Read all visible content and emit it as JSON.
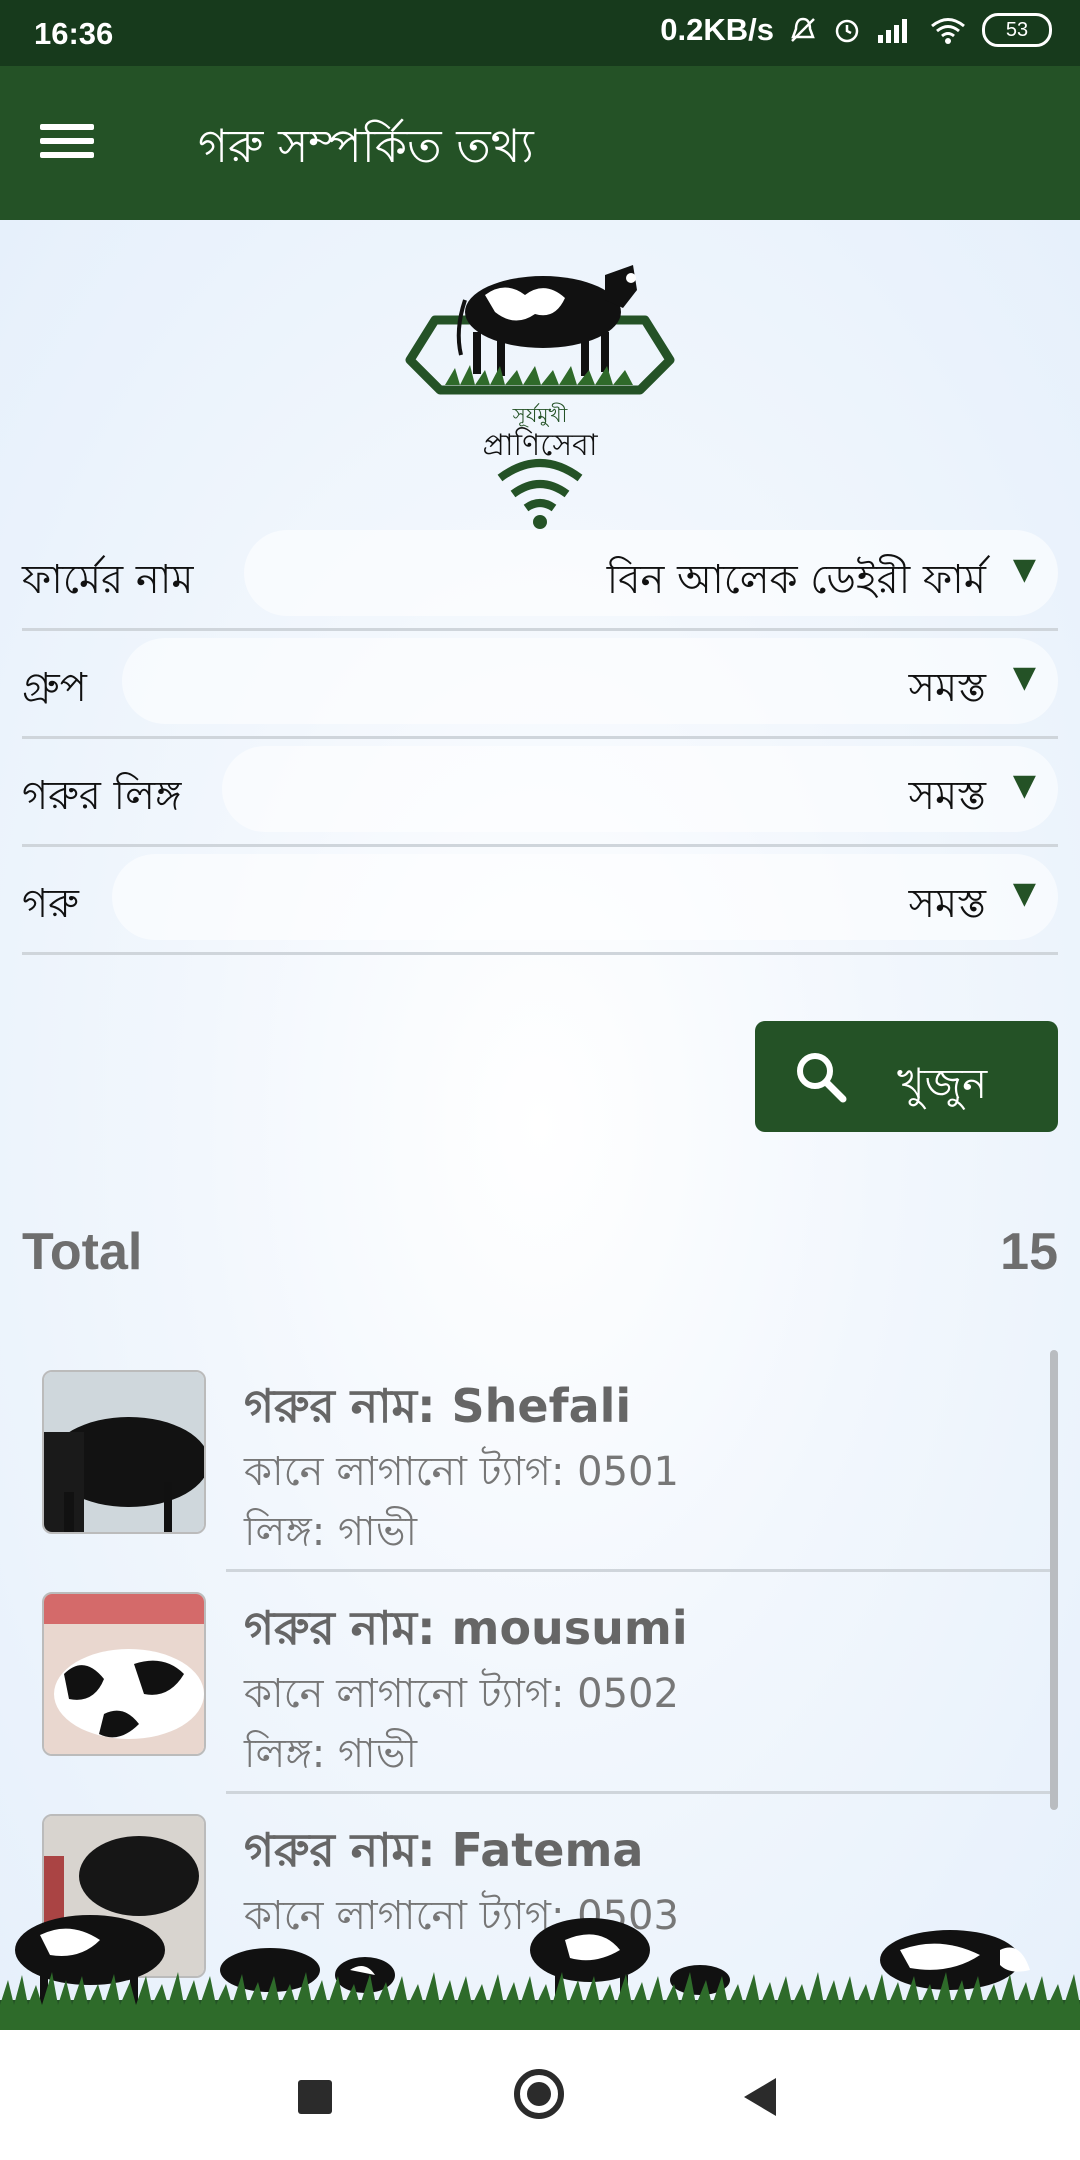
{
  "status_bar": {
    "time": "16:36",
    "network_speed": "0.2KB/s",
    "battery": "53",
    "icons": [
      "mute-icon",
      "alarm-icon",
      "signal-icon",
      "wifi-icon",
      "battery-icon"
    ]
  },
  "app_bar": {
    "menu_icon": "hamburger-menu-icon",
    "title": "গরু সম্পর্কিত তথ্য"
  },
  "logo": {
    "text_top": "সূর্যমুখী",
    "text_bottom": "প্রাণিসেবা"
  },
  "filters": [
    {
      "label": "ফার্মের নাম",
      "value": "বিন আলেক ডেইরী ফার্ম"
    },
    {
      "label": "গ্রুপ",
      "value": "সমস্ত"
    },
    {
      "label": "গরুর লিঙ্গ",
      "value": "সমস্ত"
    },
    {
      "label": "গরু",
      "value": "সমস্ত"
    }
  ],
  "search_button": {
    "label": "খুজুন",
    "icon": "search-icon"
  },
  "total": {
    "label": "Total",
    "count": "15"
  },
  "cattle": [
    {
      "name": "গরুর নাম: Shefali",
      "tag": "কানে লাগানো ট্যাগ: 0501",
      "sex": "লিঙ্গ: গাভী"
    },
    {
      "name": "গরুর নাম: mousumi",
      "tag": "কানে লাগানো ট্যাগ: 0502",
      "sex": "লিঙ্গ: গাভী"
    },
    {
      "name": "গরুর নাম: Fatema",
      "tag": "কানে লাগানো ট্যাগ: 0503",
      "sex": ""
    }
  ],
  "colors": {
    "primary": "#245226",
    "status_bar": "#173a1c",
    "background": "#eaf2fb"
  },
  "nav_bar": {
    "icons": [
      "recents-icon",
      "home-icon",
      "back-icon"
    ]
  }
}
